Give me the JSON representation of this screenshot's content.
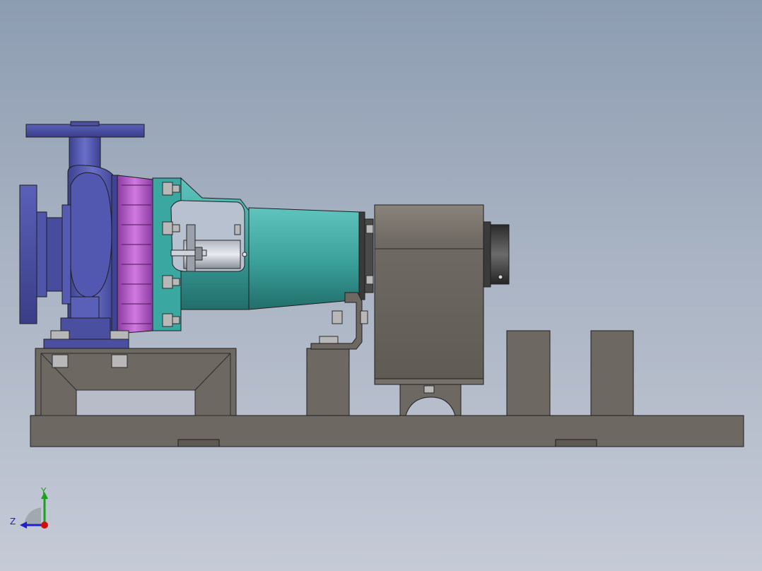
{
  "viewport": {
    "background_top": "#8d9db1",
    "background_bottom": "#c5cad6"
  },
  "model": {
    "colors": {
      "pump_casing": "#5056a8",
      "seal_cover": "#b257c4",
      "bearing_bracket": "#3aa7a0",
      "motor_frame": "#6f6a63",
      "baseplate": "#6d6862",
      "bolts": "#b8b8b8"
    }
  },
  "triad": {
    "y_label": "Y",
    "z_label": "Z",
    "y_color": "#1aa01a",
    "z_color": "#2020c8",
    "x_color": "#d01010"
  }
}
